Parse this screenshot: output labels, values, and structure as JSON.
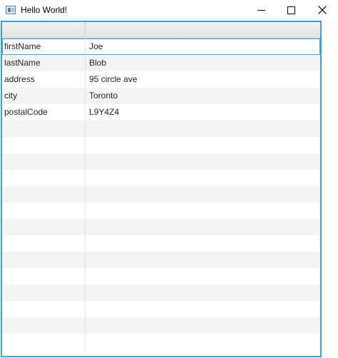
{
  "window": {
    "title": "Hello World!",
    "icon": "java-app-icon",
    "controls": {
      "minimize_icon": "minimize-icon",
      "maximize_icon": "maximize-icon",
      "close_icon": "close-icon"
    }
  },
  "table": {
    "columns": [
      "",
      ""
    ],
    "rows": [
      {
        "key": "firstName",
        "value": "Joe"
      },
      {
        "key": "lastName",
        "value": "Blob"
      },
      {
        "key": "address",
        "value": "95 circle ave"
      },
      {
        "key": "city",
        "value": "Toronto"
      },
      {
        "key": "postalCode",
        "value": "L9Y4Z4"
      }
    ],
    "focused_row_index": 0,
    "colors": {
      "focus_border": "#39a2dd",
      "row_stripe": "#f4f4f4"
    }
  }
}
